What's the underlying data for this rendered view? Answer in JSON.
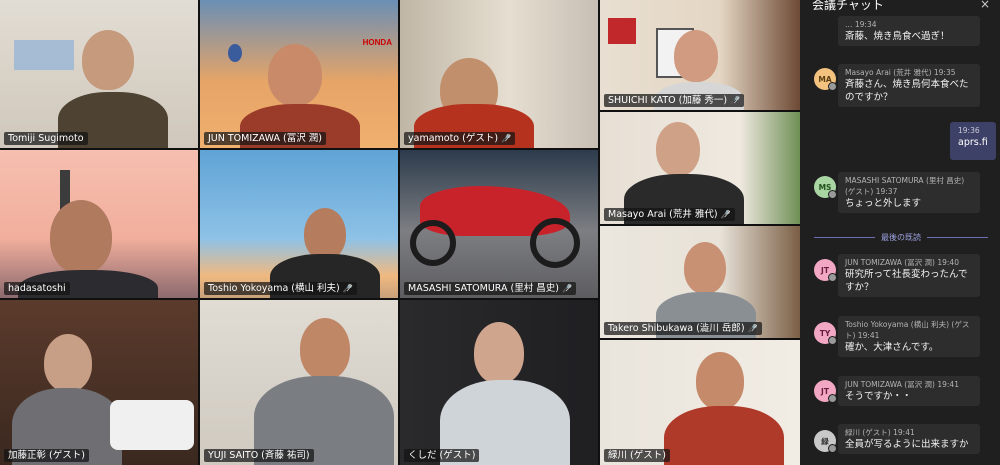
{
  "tiles": [
    {
      "name": "Tomiji Sugimoto",
      "bg": "#d9d4cc",
      "head": "#c69a7c",
      "body": "#4a3e2e",
      "badge": ""
    },
    {
      "name": "JUN TOMIZAWA (冨沢 潤)",
      "bg": "#e79c5d",
      "head": "#c98a6a",
      "body": "#9b3b2a",
      "badge": ""
    },
    {
      "name": "yamamoto (ゲスト)",
      "bg": "#cfc6b8",
      "head": "#c18f6b",
      "body": "#b5321e",
      "badge": "mic-off"
    },
    {
      "name": "SHUICHI KATO (加藤 秀一)",
      "bg": "#e6ddd0",
      "head": "#d09b80",
      "body": "#d0d0d0",
      "badge": "mic-off"
    },
    {
      "name": "hadasatoshi",
      "bg": "#f2b5a6",
      "head": "#b07a5f",
      "body": "#2c2c30",
      "badge": ""
    },
    {
      "name": "Toshio Yokoyama (横山 利夫)",
      "bg": "#7fb2d8",
      "head": "#b67c5e",
      "body": "#262626",
      "badge": "mic-off"
    },
    {
      "name": "MASASHI SATOMURA (里村 昌史)",
      "bg": "#7f7f82",
      "head": "#8b8b8f",
      "body": "#c8232b",
      "badge": "mic-off"
    },
    {
      "name": "Masayo Arai (荒井 雅代)",
      "bg": "#ece6dd",
      "head": "#cfa186",
      "body": "#2a2a2a",
      "badge": "mic-off"
    },
    {
      "name": "加藤正彰 (ゲスト)",
      "bg": "#3a2a22",
      "head": "#c79e86",
      "body": "#6e6e73",
      "badge": ""
    },
    {
      "name": "YUJI SAITO (斉藤 祐司)",
      "bg": "#d8d4cc",
      "head": "#c08766",
      "body": "#7a7d82",
      "badge": ""
    },
    {
      "name": "くしだ (ゲスト)",
      "bg": "#2a2a2c",
      "head": "#cfa58e",
      "body": "#cfd4d8",
      "badge": ""
    },
    {
      "name": "Takero Shibukawa (澁川 岳郎)",
      "bg": "#e8e2d8",
      "head": "#c99174",
      "body": "#8a8f94",
      "badge": "mic-off"
    },
    {
      "name": "緑川 (ゲスト)",
      "bg": "#ede8df",
      "head": "#c58a6a",
      "body": "#b03a2a",
      "badge": ""
    }
  ],
  "chat": {
    "title": "会議チャット",
    "close_label": "×",
    "messages": [
      {
        "initials": "",
        "avatar_color": "#f3c27f",
        "meta": "…  19:34",
        "text": "斎藤、焼き鳥食べ過ぎ！"
      },
      {
        "initials": "MA",
        "avatar_color": "#f3c27f",
        "meta": "Masayo Arai (荒井 雅代)    19:35",
        "text": "斉藤さん、焼き鳥何本食べたのですか？"
      },
      {
        "initials": "MS",
        "avatar_color": "#a8d5a2",
        "meta": "MASASHI SATOMURA (里村 昌史) (ゲスト)    19:37",
        "text": "ちょっと外します"
      },
      {
        "initials": "JT",
        "avatar_color": "#f2a7c3",
        "meta": "JUN TOMIZAWA (冨沢 潤)    19:40",
        "text": "研究所って社長変わったんですか？"
      },
      {
        "initials": "TY",
        "avatar_color": "#f2a7c3",
        "meta": "Toshio Yokoyama (横山 利夫) (ゲスト)    19:41",
        "text": "確か、大津さんです。"
      },
      {
        "initials": "JT",
        "avatar_color": "#f2a7c3",
        "meta": "JUN TOMIZAWA (冨沢 潤)    19:41",
        "text": "そうですか・・"
      },
      {
        "initials": "緑",
        "avatar_color": "#c9c9c9",
        "meta": "緑川 (ゲスト)    19:41",
        "text": "全員が写るように出来ますか"
      }
    ],
    "my_message": {
      "time": "19:36",
      "text": "aprs.fi"
    },
    "divider_label": "最後の既読"
  }
}
